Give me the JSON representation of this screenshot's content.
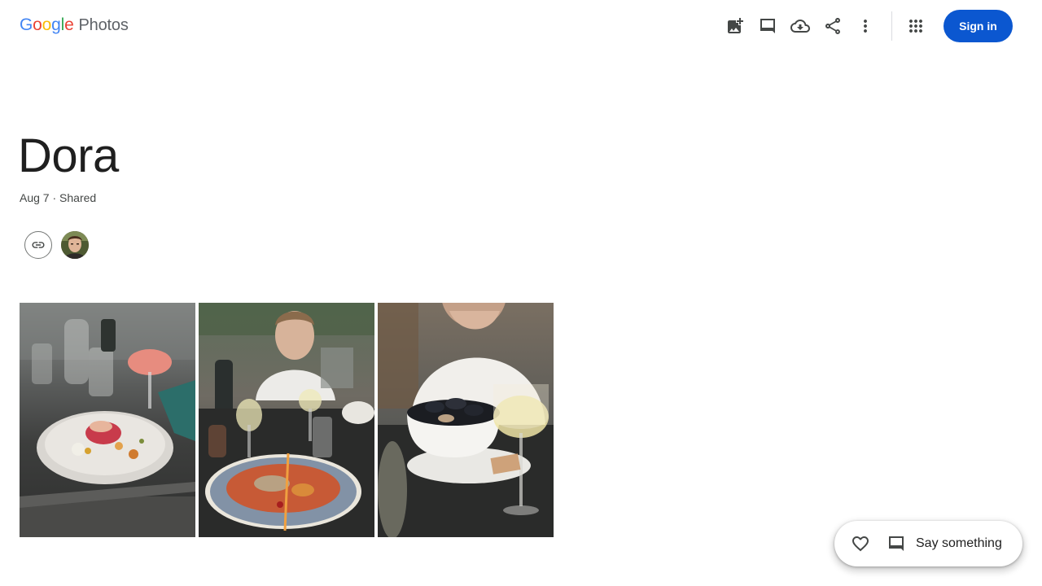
{
  "header": {
    "logo": {
      "letters": [
        "G",
        "o",
        "o",
        "g",
        "l",
        "e"
      ],
      "product": "Photos"
    },
    "actions": [
      {
        "name": "add-photos",
        "icon": "add-photo-icon"
      },
      {
        "name": "comments",
        "icon": "comment-icon"
      },
      {
        "name": "download",
        "icon": "cloud-download-icon"
      },
      {
        "name": "share",
        "icon": "share-icon"
      },
      {
        "name": "more-options",
        "icon": "more-vert-icon"
      },
      {
        "name": "google-apps",
        "icon": "apps-grid-icon"
      }
    ],
    "sign_in_label": "Sign in",
    "sign_in_color": "#0b57d0"
  },
  "album": {
    "title": "Dora",
    "meta": "Aug 7 · Shared",
    "link_icon": "link-icon",
    "owner_avatar": "avatar"
  },
  "photos": [
    {
      "subject": "plated tartare with cocktail glasses"
    },
    {
      "subject": "pasta seafood plate with wine"
    },
    {
      "subject": "bowl of mussels with white wine"
    }
  ],
  "comment_bar": {
    "heart_icon": "heart-outline-icon",
    "comment_icon": "comment-icon",
    "say_label": "Say something"
  }
}
